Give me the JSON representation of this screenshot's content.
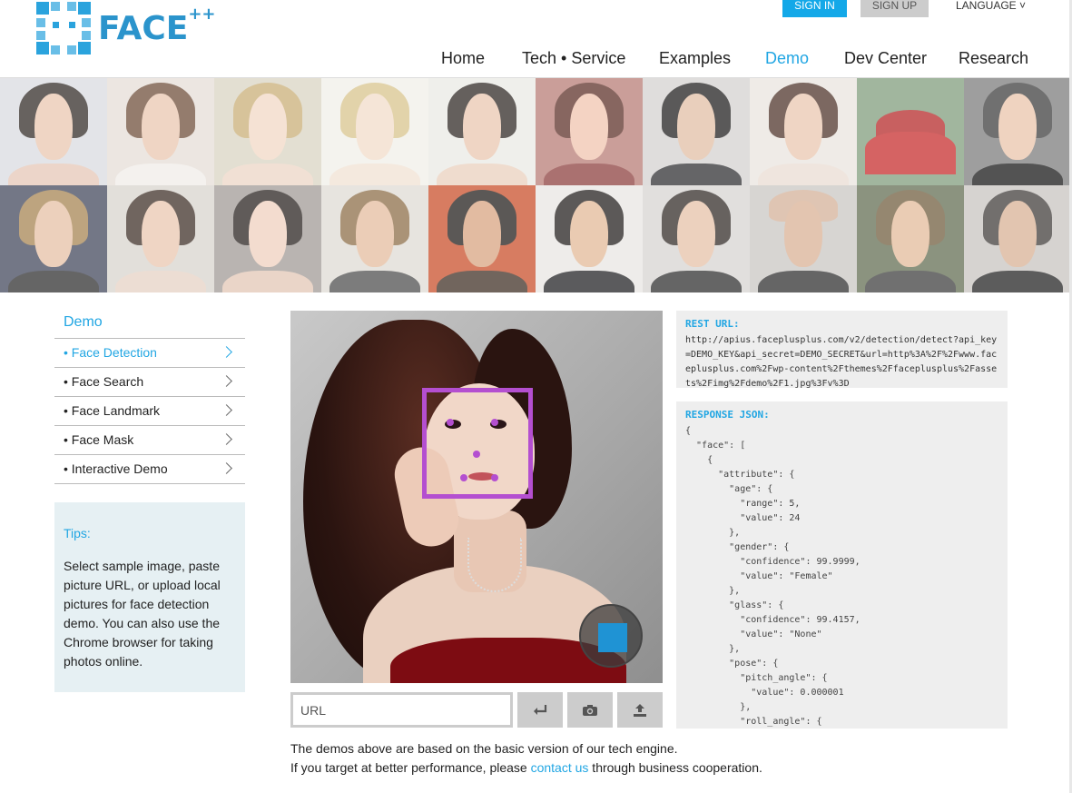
{
  "header": {
    "logo_text": "FACE",
    "logo_sup": "++",
    "sign_in": "SIGN IN",
    "sign_up": "SIGN UP",
    "language": "LANGUAGE ˅",
    "nav": [
      "Home",
      "Tech • Service",
      "Examples",
      "Demo",
      "Dev Center",
      "Research"
    ],
    "active_nav": "Demo"
  },
  "sidebar": {
    "title": "Demo",
    "items": [
      {
        "label": "• Face Detection",
        "active": true
      },
      {
        "label": "• Face Search",
        "active": false
      },
      {
        "label": "• Face Landmark",
        "active": false
      },
      {
        "label": "• Face Mask",
        "active": false
      },
      {
        "label": "• Interactive Demo",
        "active": false
      }
    ],
    "tips_title": "Tips:",
    "tips_text": "Select sample image, paste picture URL, or upload local pictures for face detection demo. You can also use the Chrome browser for taking photos online."
  },
  "url_bar": {
    "placeholder": "URL"
  },
  "note": {
    "line1": "The demos above are based on the basic version of our tech engine.",
    "line2_prefix": "If you target at better performance, please ",
    "link": "contact us",
    "line2_suffix": " through business cooperation."
  },
  "rest": {
    "title": "REST URL:",
    "url": "http://apius.faceplusplus.com/v2/detection/detect?api_key=DEMO_KEY&api_secret=DEMO_SECRET&url=http%3A%2F%2Fwww.faceplusplus.com%2Fwp-content%2Fthemes%2Ffaceplusplus%2Fassets%2Fimg%2Fdemo%2F1.jpg%3Fv%3D"
  },
  "response": {
    "title": "RESPONSE JSON:",
    "lines": [
      "{",
      "  \"face\": [",
      "    {",
      "      \"attribute\": {",
      "        \"age\": {",
      "          \"range\": 5,",
      "          \"value\": 24",
      "        },",
      "        \"gender\": {",
      "          \"confidence\": 99.9999,",
      "          \"value\": \"Female\"",
      "        },",
      "        \"glass\": {",
      "          \"confidence\": 99.4157,",
      "          \"value\": \"None\"",
      "        },",
      "        \"pose\": {",
      "          \"pitch_angle\": {",
      "            \"value\": 0.000001",
      "          },",
      "          \"roll_angle\": {"
    ]
  },
  "colors": {
    "accent": "#21a6e3",
    "face_box": "#b44fd0"
  }
}
